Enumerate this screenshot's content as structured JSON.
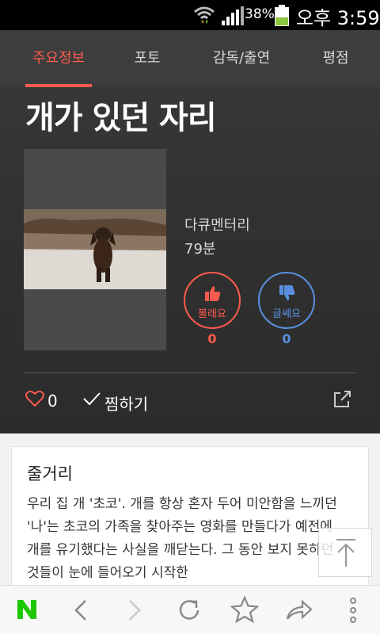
{
  "status_bar": {
    "battery_percent": "38%",
    "time": "오후 3:59"
  },
  "tabs": [
    {
      "label": "주요정보",
      "active": true
    },
    {
      "label": "포토",
      "active": false
    },
    {
      "label": "감독/출연",
      "active": false
    },
    {
      "label": "평점",
      "active": false
    }
  ],
  "movie": {
    "title": "개가 있던 자리",
    "genre": "다큐멘터리",
    "runtime": "79분"
  },
  "votes": {
    "like_label": "볼래요",
    "like_count": "0",
    "dislike_label": "글쎄요",
    "dislike_count": "0"
  },
  "actions": {
    "heart_count": "0",
    "zzim_label": "찜하기"
  },
  "synopsis": {
    "title": "줄거리",
    "body": "우리 집 개 '초코'. 개를 항상 혼자 두어 미안함을 느끼던 '나'는 초코의 가족을 찾아주는 영화를 만들다가 예전에 개를 유기했다는 사실을 깨닫는다. 그 동안 보지 못하던 것들이 눈에 들어오기 시작한"
  },
  "colors": {
    "accent_red": "#ff5a4f",
    "accent_blue": "#5a8fe0",
    "naver_green": "#1ec800"
  },
  "icons": {
    "bottom_nav": [
      "naver-logo",
      "back-arrow",
      "forward-arrow",
      "refresh",
      "bookmark-star",
      "share-arrow",
      "more-vertical"
    ]
  }
}
